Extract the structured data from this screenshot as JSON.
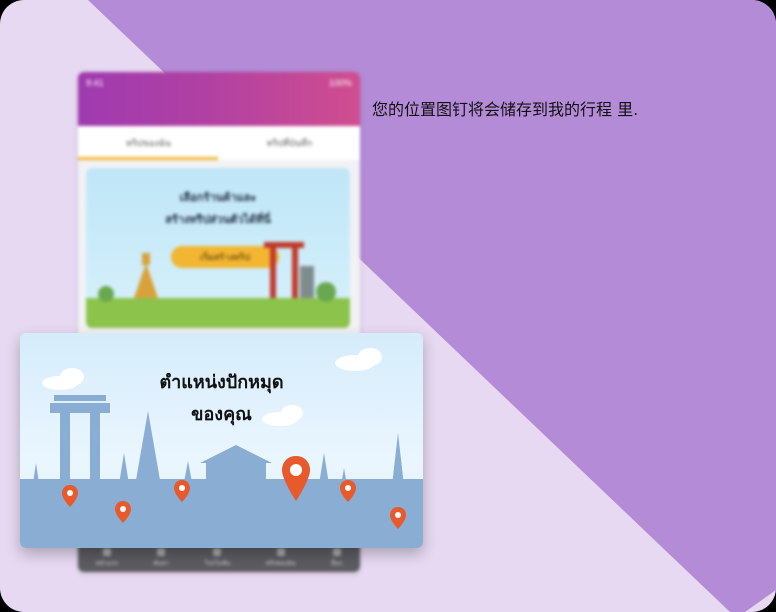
{
  "message": {
    "text": "您的位置图钉将会储存到我的行程 里."
  },
  "phone": {
    "status": {
      "left": "9:41",
      "right": "100%"
    },
    "tabs": [
      {
        "label": "ทริปของฉัน"
      },
      {
        "label": "ทริปที่บันทึก"
      }
    ],
    "hero": {
      "line1": "เลือกร้านค้าและ",
      "line2": "สร้างทริปส่วนตัวได้ที่นี่",
      "button_label": "เริ่มสร้างทริป"
    },
    "bottom_nav": [
      {
        "label": "หน้าแรก"
      },
      {
        "label": "ค้นหา"
      },
      {
        "label": "โปรโมชั่น"
      },
      {
        "label": "ทริปของฉัน"
      },
      {
        "label": "อื่นๆ"
      }
    ]
  },
  "card": {
    "title_line1": "ตำแหน่งปักหมุด",
    "title_line2": "ของคุณ",
    "pins": [
      {
        "name": "pin-1"
      },
      {
        "name": "pin-2"
      },
      {
        "name": "pin-3"
      },
      {
        "name": "pin-main"
      },
      {
        "name": "pin-4"
      },
      {
        "name": "pin-5"
      }
    ]
  },
  "colors": {
    "purple": "#b48bd6",
    "lavender": "#e6d9f1",
    "pin": "#e85a2c",
    "skyline": "#8aaed3"
  }
}
